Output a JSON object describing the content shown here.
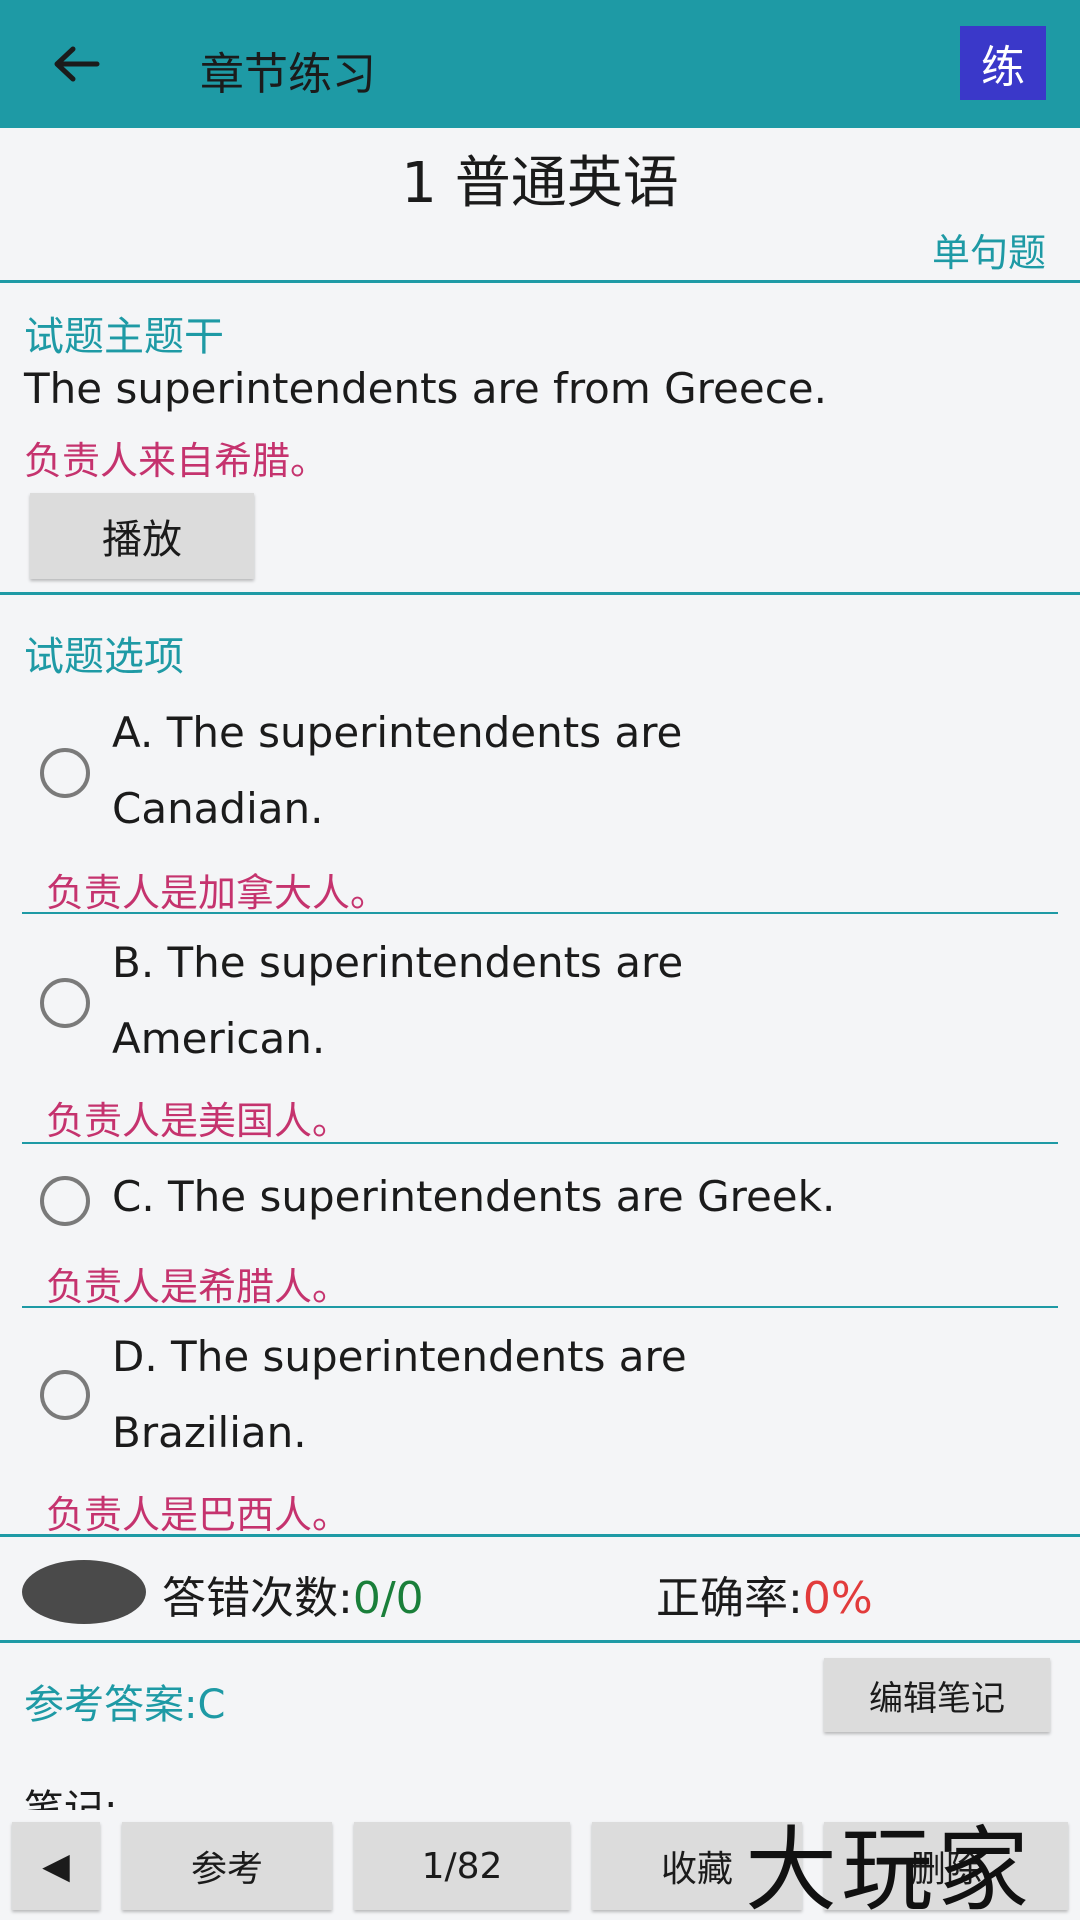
{
  "appbar": {
    "back_icon": "arrow-left-icon",
    "title": "章节练习",
    "badge": "练",
    "badge_color": "#3a38c9",
    "bar_color": "#1e9aa5"
  },
  "chapter": {
    "title": "1 普通英语",
    "question_type": "单句题"
  },
  "stem": {
    "label": "试题主题干",
    "english": "The superintendents are from Greece.",
    "chinese": "负责人来自希腊。",
    "play_label": "播放"
  },
  "options": {
    "label": "试题选项",
    "items": [
      {
        "en_line1": "A. The superintendents are",
        "en_line2": "Canadian.",
        "cn": "负责人是加拿大人。"
      },
      {
        "en_line1": "B. The superintendents are",
        "en_line2": "American.",
        "cn": "负责人是美国人。"
      },
      {
        "en_line1": "C. The superintendents are Greek.",
        "en_line2": "",
        "cn": "负责人是希腊人。"
      },
      {
        "en_line1": "D. The superintendents are",
        "en_line2": "Brazilian.",
        "cn": "负责人是巴西人。"
      }
    ]
  },
  "stats": {
    "wrong_label": "答错次数:",
    "wrong_value": "0/0",
    "accuracy_label": "正确率:",
    "accuracy_value": "0%"
  },
  "answer": {
    "reference": "参考答案:C",
    "edit_note_label": "编辑笔记",
    "notes_label": "笔记:"
  },
  "bottombar": {
    "prev_icon": "triangle-left-icon",
    "prev_label": "◀",
    "reference_label": "参考",
    "page_indicator": "1/82",
    "favorite_label": "收藏",
    "delete_label": "删除"
  },
  "watermark": "大玩家",
  "colors": {
    "accent": "#1e9aa5",
    "translation": "#c5336e",
    "accuracy": "#e23b3b",
    "wrong_count": "#1a7f3a"
  }
}
